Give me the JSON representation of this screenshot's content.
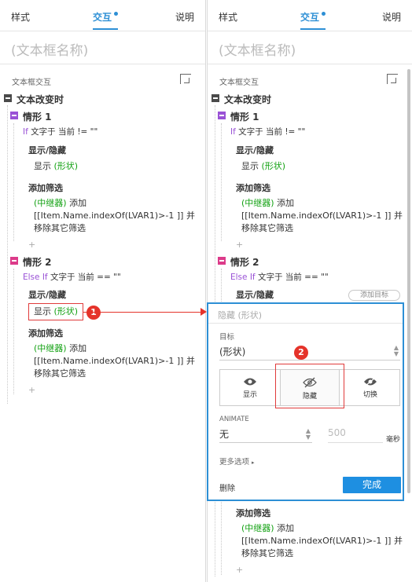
{
  "tabs": {
    "style": "样式",
    "interaction": "交互",
    "explain": "说明"
  },
  "name_placeholder": "(文本框名称)",
  "section_header": "文本框交互",
  "event": "文本改变时",
  "case1": {
    "label": "情形 1",
    "cond_kw": "If",
    "cond_text": "文字于 当前 != \"\"",
    "action1_title": "显示/隐藏",
    "action1_verb": "显示",
    "action1_target": "(形状)",
    "action2_title": "添加筛选",
    "action2_target": "(中继器)",
    "action2_verb": "添加",
    "action2_line2": "[[Item.Name.indexOf(LVAR1)>-1 ]] 并",
    "action2_line3": "移除其它筛选",
    "plus": "+"
  },
  "case2": {
    "label": "情形 2",
    "cond_kw": "Else If",
    "cond_text": "文字于 当前 == \"\"",
    "action1_title": "显示/隐藏",
    "action1_verb": "显示",
    "action1_target": "(形状)",
    "action2_title": "添加筛选",
    "action2_target": "(中继器)",
    "action2_verb": "添加",
    "action2_line2": "[[Item.Name.indexOf(LVAR1)>-1 ]] 并",
    "action2_line3": "移除其它筛选",
    "plus": "+"
  },
  "badges": {
    "one": "1",
    "two": "2"
  },
  "add_target": "添加目标",
  "dialog": {
    "title": "隐藏 (形状)",
    "target_label": "目标",
    "target_value": "(形状)",
    "seg_show": "显示",
    "seg_hide": "隐藏",
    "seg_toggle": "切换",
    "animate_label": "ANIMATE",
    "animate_value": "无",
    "duration_value": "500",
    "duration_unit": "毫秒",
    "more_options": "更多选项",
    "delete": "删除",
    "done": "完成"
  },
  "colors": {
    "accent": "#2d8fd5",
    "purple": "#9a52d6",
    "pink": "#dc3b8a",
    "green": "#12a112",
    "red": "#e5332a"
  }
}
